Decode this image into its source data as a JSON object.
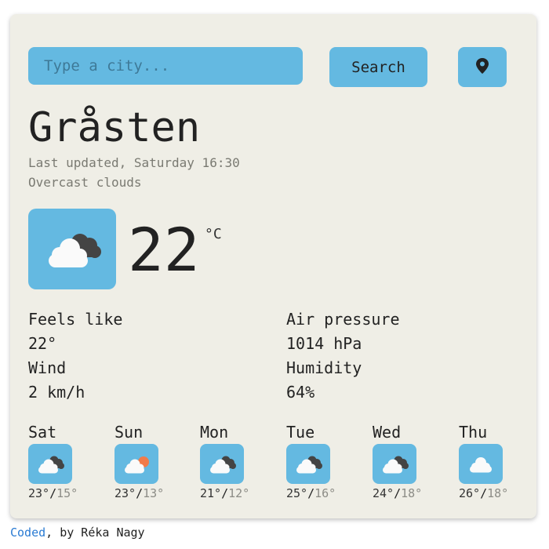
{
  "search": {
    "placeholder": "Type a city...",
    "button_label": "Search"
  },
  "location_button": {
    "icon": "map-pin-icon"
  },
  "current": {
    "city": "Gråsten",
    "last_updated": "Last updated, Saturday 16:30",
    "description": "Overcast clouds",
    "icon": "overcast-clouds-icon",
    "temperature": "22",
    "unit": "°C"
  },
  "details": {
    "feels_like_label": "Feels like",
    "feels_like_value": "22°",
    "wind_label": "Wind",
    "wind_value": "2 km/h",
    "pressure_label": "Air pressure",
    "pressure_value": "1014 hPa",
    "humidity_label": "Humidity",
    "humidity_value": "64%"
  },
  "forecast": [
    {
      "day": "Sat",
      "icon": "broken-clouds-icon",
      "high": "23°",
      "low": "15°"
    },
    {
      "day": "Sun",
      "icon": "clouds-sun-icon",
      "high": "23°",
      "low": "13°"
    },
    {
      "day": "Mon",
      "icon": "broken-clouds-icon",
      "high": "21°",
      "low": "12°"
    },
    {
      "day": "Tue",
      "icon": "broken-clouds-icon",
      "high": "25°",
      "low": "16°"
    },
    {
      "day": "Wed",
      "icon": "broken-clouds-icon",
      "high": "24°",
      "low": "18°"
    },
    {
      "day": "Thu",
      "icon": "cloud-icon",
      "high": "26°",
      "low": "18°"
    }
  ],
  "footer": {
    "link_text": "Coded",
    "rest": ", by Réka Nagy"
  },
  "colors": {
    "accent": "#64b9e1",
    "card_bg": "#efeee6",
    "sun": "#f07b4a",
    "dark_cloud": "#444444",
    "link": "#2a7bd3"
  }
}
